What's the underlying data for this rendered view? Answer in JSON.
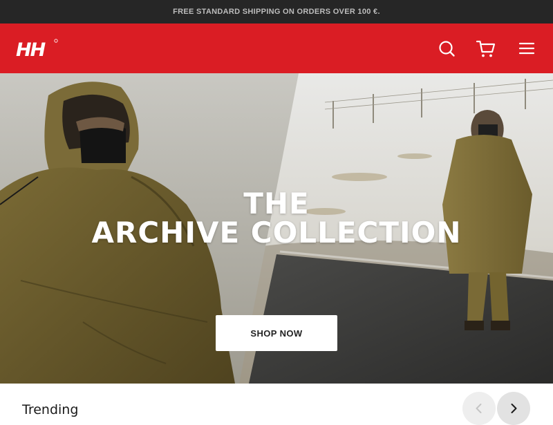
{
  "promo_bar": {
    "text": "FREE STANDARD SHIPPING ON ORDERS OVER 100 €."
  },
  "header": {
    "brand": "HH",
    "bg_color": "#da1d24",
    "icons": [
      "search-icon",
      "cart-icon",
      "menu-icon"
    ]
  },
  "hero": {
    "title_line1": "THE",
    "title_line2": "ARCHIVE COLLECTION",
    "cta_label": "SHOP NOW"
  },
  "trending": {
    "title": "Trending",
    "prev_icon": "chevron-left-icon",
    "next_icon": "chevron-right-icon"
  }
}
